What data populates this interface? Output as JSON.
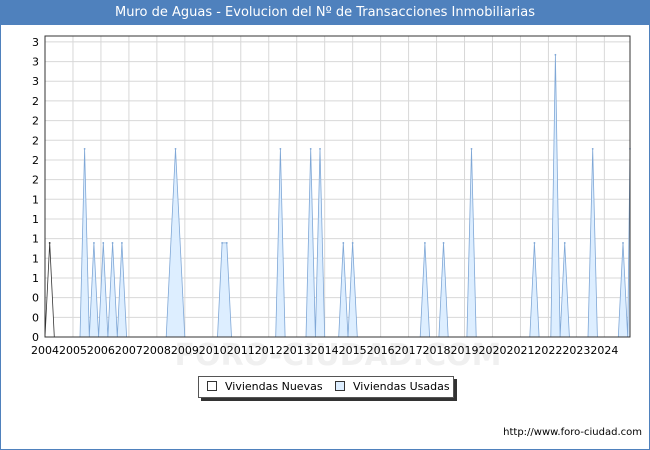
{
  "header": {
    "title": "Muro de Aguas - Evolucion del Nº de Transacciones Inmobiliarias"
  },
  "footer": {
    "source": "http://www.foro-ciudad.com"
  },
  "watermark": "FORO-CIUDAD.COM",
  "colors": {
    "title_bg": "#4f81bd",
    "nuevas_fill": "#ffffff",
    "nuevas_stroke": "#333333",
    "usadas_fill": "#ddeeff",
    "usadas_stroke": "#7fa7d6",
    "grid": "#d8d8d8"
  },
  "chart_data": {
    "type": "area",
    "title": "Muro de Aguas - Evolucion del Nº de Transacciones Inmobiliarias",
    "xlabel": "",
    "ylabel": "",
    "ylim": [
      0,
      3.2
    ],
    "y_tick_labels": [
      "0",
      "0",
      "0",
      "1",
      "1",
      "1",
      "1",
      "1",
      "2",
      "2",
      "2",
      "2",
      "2",
      "3",
      "3",
      "3"
    ],
    "x_tick_labels": [
      "2004",
      "2005",
      "2006",
      "2007",
      "2008",
      "2009",
      "2010",
      "2011",
      "2012",
      "2013",
      "2014",
      "2015",
      "2016",
      "2017",
      "2018",
      "2019",
      "2020",
      "2021",
      "2022",
      "2023",
      "2024"
    ],
    "x_range": [
      "2004-01",
      "2024-12"
    ],
    "grid": true,
    "legend_position": "bottom-center",
    "series": [
      {
        "name": "Viviendas Nuevas",
        "style": "area",
        "x": [
          "2004-01",
          "2004-03",
          "2004-05"
        ],
        "y": [
          0,
          1,
          0
        ]
      },
      {
        "name": "Viviendas Usadas",
        "style": "area",
        "x": [
          "2005-04",
          "2005-06",
          "2005-08",
          "2005-10",
          "2005-12",
          "2006-02",
          "2006-04",
          "2006-06",
          "2006-08",
          "2006-10",
          "2006-12",
          "2007-02",
          "2008-05",
          "2008-09",
          "2009-01",
          "2010-03",
          "2010-05",
          "2010-07",
          "2010-09",
          "2010-11",
          "2012-04",
          "2012-06",
          "2012-08",
          "2013-05",
          "2013-07",
          "2013-09",
          "2013-11",
          "2014-01",
          "2014-07",
          "2014-09",
          "2014-11",
          "2015-01",
          "2015-03",
          "2015-05",
          "2017-06",
          "2017-08",
          "2017-10",
          "2018-02",
          "2018-04",
          "2018-06",
          "2019-02",
          "2019-04",
          "2019-06",
          "2021-05",
          "2021-07",
          "2021-09",
          "2022-02",
          "2022-04",
          "2022-06",
          "2022-08",
          "2022-10",
          "2023-06",
          "2023-08",
          "2023-10",
          "2024-07",
          "2024-09",
          "2024-11",
          "2024-12"
        ],
        "y": [
          0,
          2,
          0,
          1,
          0,
          1,
          0,
          1,
          0,
          1,
          0,
          0,
          0,
          2,
          0,
          0,
          1,
          1,
          0,
          0,
          0,
          2,
          0,
          0,
          2,
          0,
          2,
          0,
          0,
          1,
          0,
          1,
          0,
          0,
          0,
          1,
          0,
          0,
          1,
          0,
          0,
          2,
          0,
          0,
          1,
          0,
          0,
          3,
          0,
          1,
          0,
          0,
          2,
          0,
          0,
          1,
          0,
          2
        ]
      }
    ]
  }
}
